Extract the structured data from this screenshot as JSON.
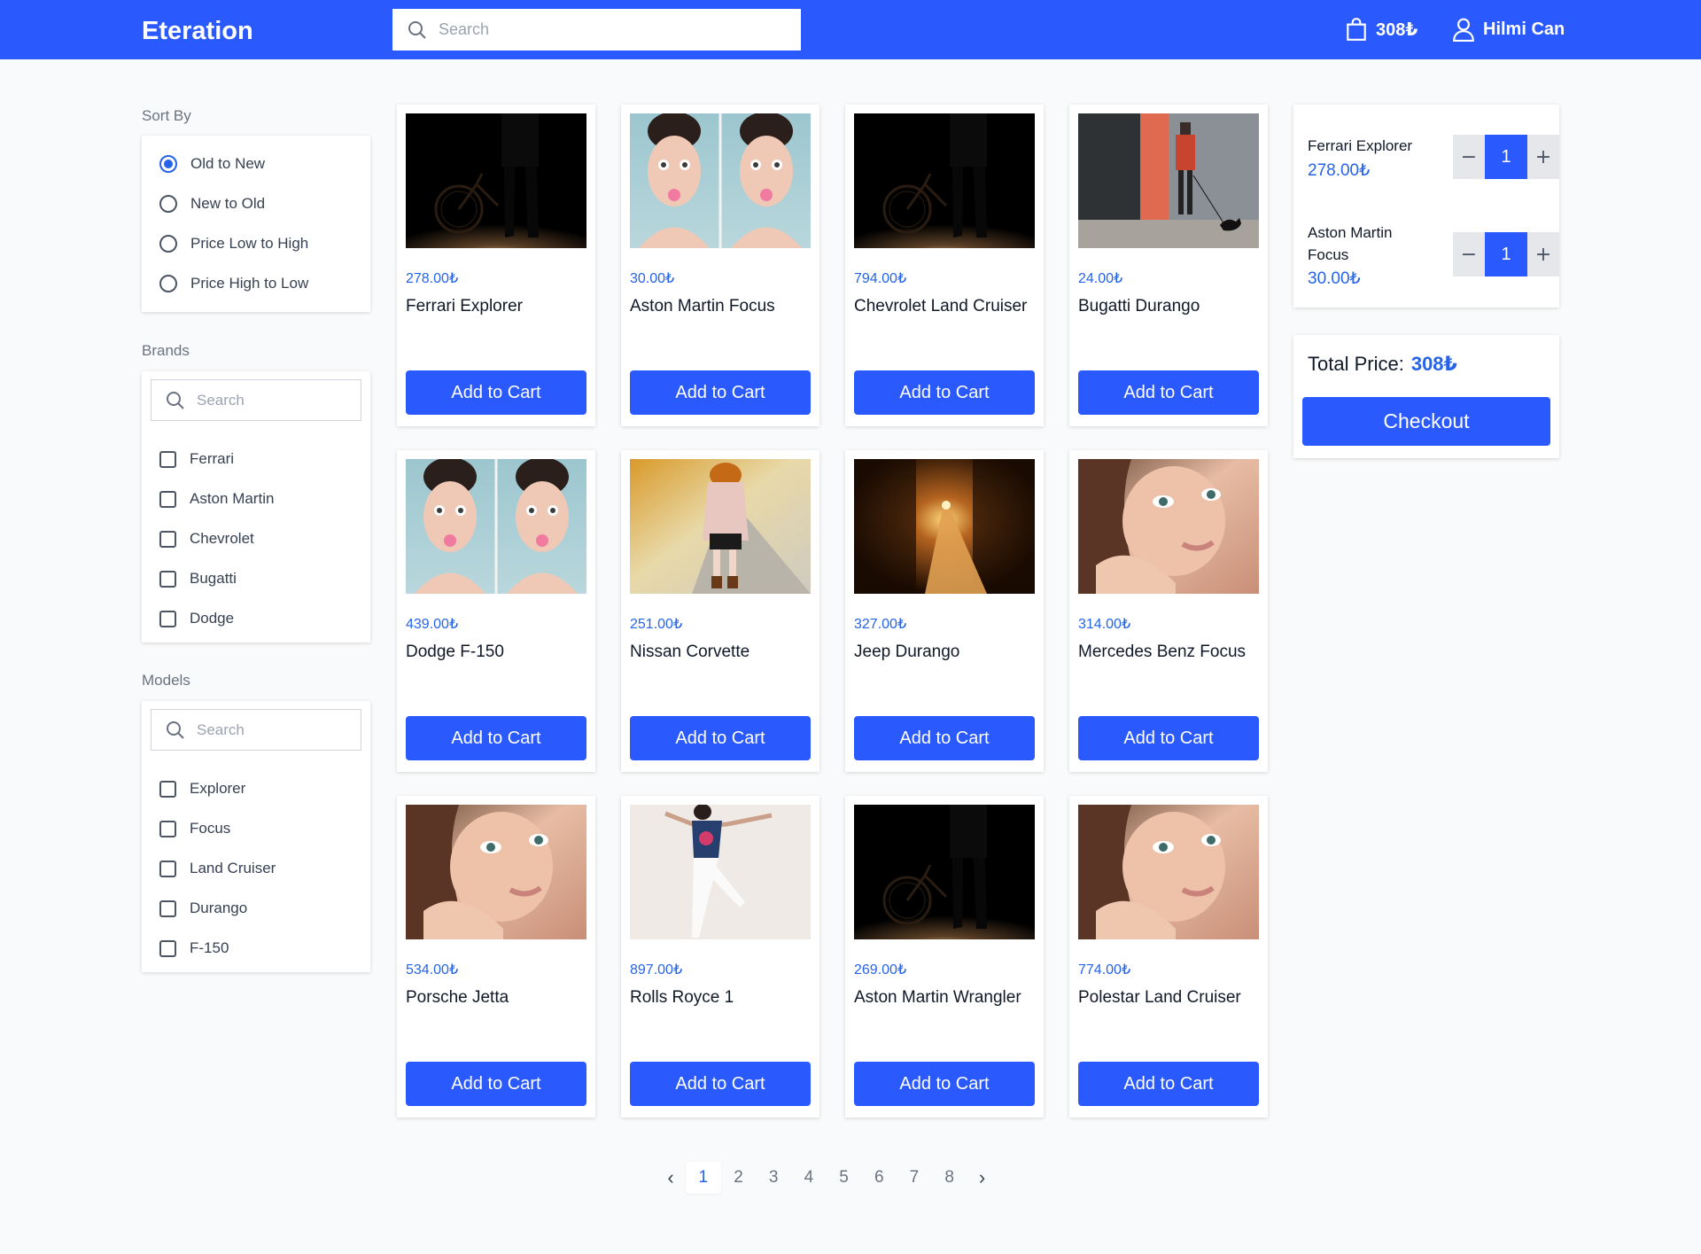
{
  "header": {
    "brand": "Eteration",
    "search_placeholder": "Search",
    "cart_total": "308₺",
    "user_name": "Hilmi Can"
  },
  "sort": {
    "title": "Sort By",
    "options": [
      "Old to New",
      "New to Old",
      "Price Low to High",
      "Price High to Low"
    ],
    "selected": "Old to New"
  },
  "brands": {
    "title": "Brands",
    "search_placeholder": "Search",
    "items": [
      "Ferrari",
      "Aston Martin",
      "Chevrolet",
      "Bugatti",
      "Dodge"
    ]
  },
  "models": {
    "title": "Models",
    "search_placeholder": "Search",
    "items": [
      "Explorer",
      "Focus",
      "Land Cruiser",
      "Durango",
      "F-150"
    ]
  },
  "add_label": "Add to Cart",
  "products": [
    {
      "price": "278.00₺",
      "name": "Ferrari Explorer",
      "image": "bicycle-night"
    },
    {
      "price": "30.00₺",
      "name": "Aston Martin Focus",
      "image": "woman-bubblegum"
    },
    {
      "price": "794.00₺",
      "name": "Chevrolet Land Cruiser",
      "image": "bicycle-night"
    },
    {
      "price": "24.00₺",
      "name": "Bugatti Durango",
      "image": "woman-street-dog"
    },
    {
      "price": "439.00₺",
      "name": "Dodge F-150",
      "image": "woman-bubblegum"
    },
    {
      "price": "251.00₺",
      "name": "Nissan Corvette",
      "image": "woman-autumn-road"
    },
    {
      "price": "327.00₺",
      "name": "Jeep Durango",
      "image": "forest-path"
    },
    {
      "price": "314.00₺",
      "name": "Mercedes Benz Focus",
      "image": "woman-portrait"
    },
    {
      "price": "534.00₺",
      "name": "Porsche Jetta",
      "image": "woman-portrait"
    },
    {
      "price": "897.00₺",
      "name": "Rolls Royce 1",
      "image": "woman-jumping"
    },
    {
      "price": "269.00₺",
      "name": "Aston Martin Wrangler",
      "image": "bicycle-night"
    },
    {
      "price": "774.00₺",
      "name": "Polestar Land Cruiser",
      "image": "woman-portrait"
    }
  ],
  "cart": {
    "items": [
      {
        "name": "Ferrari Explorer",
        "price": "278.00₺",
        "qty": "1"
      },
      {
        "name": "Aston Martin Focus",
        "price": "30.00₺",
        "qty": "1"
      }
    ],
    "minus": "−",
    "plus": "+",
    "total_label": "Total Price:",
    "total_value": "308₺",
    "checkout_label": "Checkout"
  },
  "pagination": {
    "prev": "‹",
    "next": "›",
    "pages": [
      "1",
      "2",
      "3",
      "4",
      "5",
      "6",
      "7",
      "8"
    ],
    "current": "1"
  },
  "colors": {
    "primary": "#2a59fe",
    "price": "#2563eb",
    "background": "#f9fafb"
  }
}
